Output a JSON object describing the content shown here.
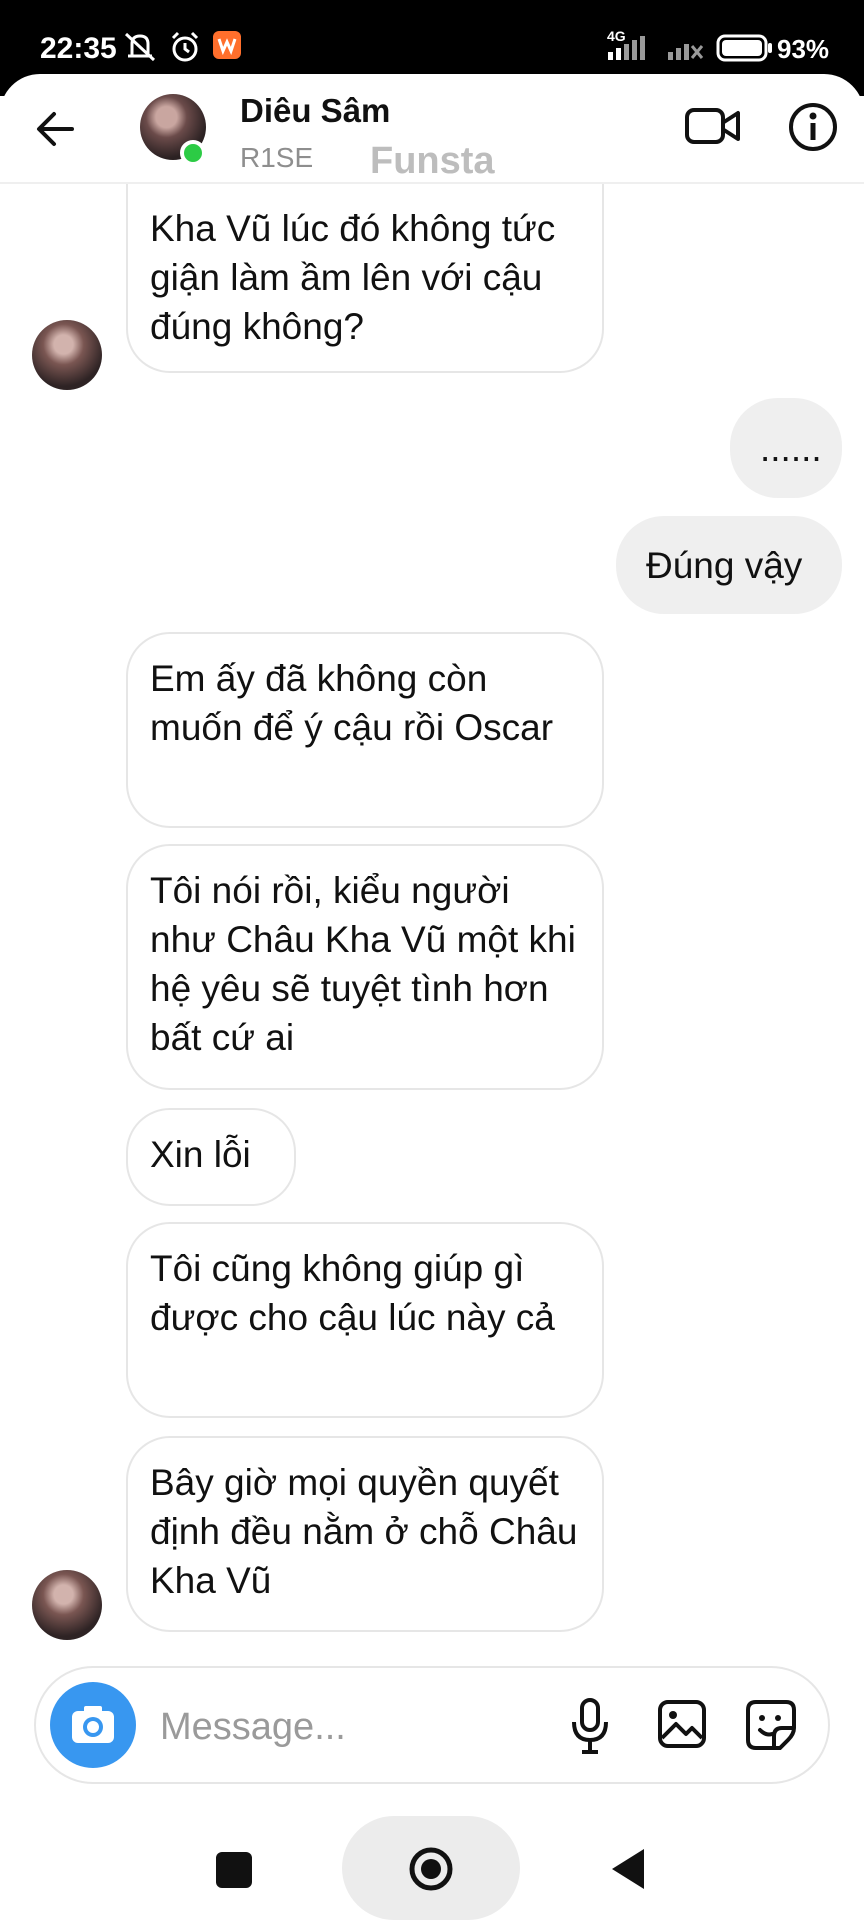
{
  "status_bar": {
    "time": "22:35",
    "network": "4G",
    "battery_percent": "93%",
    "icons": [
      "mute-icon",
      "alarm-icon",
      "app-notification-icon",
      "signal-icon",
      "battery-icon"
    ]
  },
  "header": {
    "name": "Diêu Sâm",
    "subtitle": "R1SE",
    "subtitle_overlay": "Funsta",
    "online": true,
    "icons": [
      "back-arrow-icon",
      "video-call-icon",
      "info-icon"
    ]
  },
  "messages": [
    {
      "side": "in",
      "text": "Kha Vũ lúc đó không tức giận làm ầm lên với cậu đúng không?"
    },
    {
      "side": "out",
      "text": "......"
    },
    {
      "side": "out",
      "text": "Đúng vậy"
    },
    {
      "side": "in",
      "text": "Em ấy đã không còn muốn để ý cậu rồi Oscar"
    },
    {
      "side": "in",
      "text": "Tôi nói rồi, kiểu người như Châu Kha Vũ một khi hệ yêu sẽ tuyệt tình hơn bất cứ ai"
    },
    {
      "side": "in",
      "text": "Xin lỗi"
    },
    {
      "side": "in",
      "text": "Tôi cũng không giúp gì được cho cậu lúc này cả"
    },
    {
      "side": "in",
      "text": "Bây giờ mọi quyền quyết định đều nằm ở chỗ Châu Kha Vũ"
    }
  ],
  "composer": {
    "placeholder": "Message...",
    "icons": [
      "camera-icon",
      "microphone-icon",
      "gallery-icon",
      "sticker-icon"
    ]
  },
  "colors": {
    "online": "#2ccb45",
    "camera_button": "#3897f0",
    "outgoing_bubble": "#efefef",
    "incoming_border": "#e6e6e6"
  }
}
